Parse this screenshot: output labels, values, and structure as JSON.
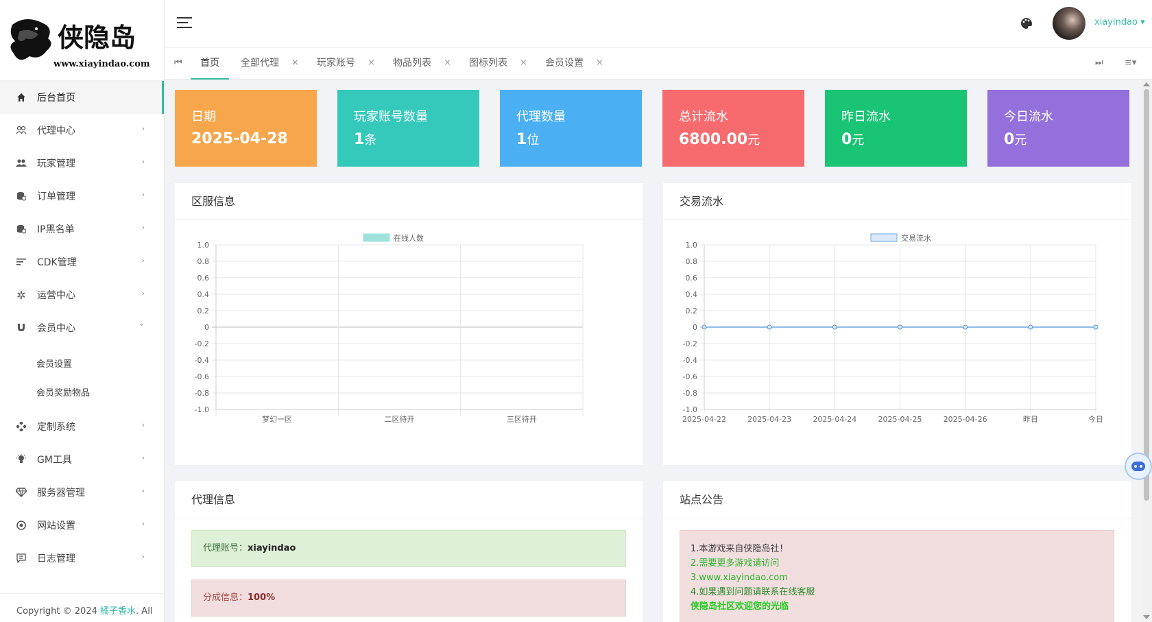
{
  "logo": {
    "text": "侠隐岛",
    "url": "www.xiayindao.com"
  },
  "sidebar": {
    "items": [
      {
        "label": "后台首页",
        "icon": "home-icon",
        "active": true,
        "arrow": ""
      },
      {
        "label": "代理中心",
        "icon": "users-icon",
        "arrow": "›"
      },
      {
        "label": "玩家管理",
        "icon": "group-icon",
        "arrow": "›"
      },
      {
        "label": "订单管理",
        "icon": "database-icon",
        "arrow": "›"
      },
      {
        "label": "IP黑名单",
        "icon": "database-icon",
        "arrow": "›"
      },
      {
        "label": "CDK管理",
        "icon": "list-icon",
        "arrow": "›"
      },
      {
        "label": "运营中心",
        "icon": "gear-icon",
        "arrow": "›"
      },
      {
        "label": "会员中心",
        "icon": "magnet-icon",
        "arrow": "⌄"
      }
    ],
    "subitems": [
      "会员设置",
      "会员奖励物品"
    ],
    "items2": [
      {
        "label": "定制系统",
        "icon": "puzzle-icon",
        "arrow": "›"
      },
      {
        "label": "GM工具",
        "icon": "bulb-icon",
        "arrow": "›"
      },
      {
        "label": "服务器管理",
        "icon": "diamond-icon",
        "arrow": "›"
      },
      {
        "label": "网站设置",
        "icon": "globe-icon",
        "arrow": "›"
      },
      {
        "label": "日志管理",
        "icon": "comment-icon",
        "arrow": "›"
      }
    ],
    "footer": {
      "prefix": "Copyright © 2024 ",
      "link": "橘子香水",
      "suffix": ". All"
    }
  },
  "header": {
    "username": "xiayindao ▾"
  },
  "tabs": {
    "items": [
      "首页",
      "全部代理",
      "玩家账号",
      "物品列表",
      "图标列表",
      "会员设置"
    ],
    "close": "×",
    "first_icon": "⏮",
    "last_icon": "⏭",
    "menu_icon": "≡▾"
  },
  "stats": [
    {
      "title": "日期",
      "value": "2025-04-28",
      "unit": "",
      "color": "#f8a64b"
    },
    {
      "title": "玩家账号数量",
      "value": "1",
      "unit": "条",
      "color": "#35c9bb"
    },
    {
      "title": "代理数量",
      "value": "1",
      "unit": "位",
      "color": "#4aaff3"
    },
    {
      "title": "总计流水",
      "value": "6800.00",
      "unit": "元",
      "color": "#f76a6d"
    },
    {
      "title": "昨日流水",
      "value": "0",
      "unit": "元",
      "color": "#19c474"
    },
    {
      "title": "今日流水",
      "value": "0",
      "unit": "元",
      "color": "#9370db"
    }
  ],
  "panels": {
    "server": {
      "title": "区服信息"
    },
    "trade": {
      "title": "交易流水"
    },
    "agent": {
      "title": "代理信息",
      "account_label": "代理账号：",
      "account_value": "xiayindao",
      "share_label": "分成信息：",
      "share_value": "100%"
    },
    "notice": {
      "title": "站点公告",
      "lines": [
        {
          "text": "1.本游戏来自侠隐岛社！",
          "color": "#3c3c3c"
        },
        {
          "text": "2.需要更多游戏请访问",
          "color": "#2db52d"
        },
        {
          "text": "3.www.xiayindao.com",
          "color": "#2db52d"
        },
        {
          "text": "4.如果遇到问题请联系在线客服",
          "color": "#2a8a2a"
        },
        {
          "text": "侠隐岛社区欢迎您的光临",
          "color": "#22cc22"
        }
      ]
    }
  },
  "chart_data": [
    {
      "type": "bar",
      "title": "",
      "legend": "在线人数",
      "categories": [
        "梦幻一区",
        "二区待开",
        "三区待开"
      ],
      "series": [
        {
          "name": "在线人数",
          "values": [
            0,
            0,
            0
          ]
        }
      ],
      "ylim": [
        -1.0,
        1.0
      ],
      "yticks": [
        "1.0",
        "0.8",
        "0.6",
        "0.4",
        "0.2",
        "0",
        "-0.2",
        "-0.4",
        "-0.6",
        "-0.8",
        "-1.0"
      ],
      "grid": true,
      "legend_position": "top-center",
      "colors": {
        "legend_fill": "#9fe2db",
        "legend_stroke": "#9fe2db"
      }
    },
    {
      "type": "line",
      "title": "",
      "legend": "交易流水",
      "categories": [
        "2025-04-22",
        "2025-04-23",
        "2025-04-24",
        "2025-04-25",
        "2025-04-26",
        "昨日",
        "今日"
      ],
      "series": [
        {
          "name": "交易流水",
          "values": [
            0,
            0,
            0,
            0,
            0,
            0,
            0
          ]
        }
      ],
      "ylim": [
        -1.0,
        1.0
      ],
      "yticks": [
        "1.0",
        "0.8",
        "0.6",
        "0.4",
        "0.2",
        "0",
        "-0.2",
        "-0.4",
        "-0.6",
        "-0.8",
        "-1.0"
      ],
      "grid": true,
      "legend_position": "top-center",
      "colors": {
        "legend_fill": "#dbe9fa",
        "legend_stroke": "#6ba5e7",
        "line": "#4a90d9"
      }
    }
  ]
}
